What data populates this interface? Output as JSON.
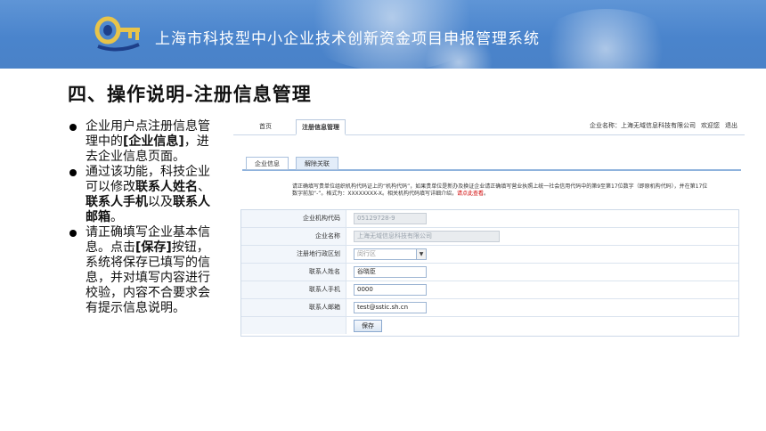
{
  "banner": {
    "title": "上海市科技型中小企业技术创新资金项目申报管理系统",
    "bg_color": "#4a84cc"
  },
  "logo": {
    "icon": "key-logo-icon",
    "color": "#e8c44a"
  },
  "slide": {
    "title": "四、操作说明-注册信息管理"
  },
  "bullets": [
    {
      "parts": [
        {
          "t": "企业用户点注册信息管理中的",
          "b": false
        },
        {
          "t": "[企业信息]",
          "b": true
        },
        {
          "t": "，进去企业信息页面。",
          "b": false
        }
      ]
    },
    {
      "parts": [
        {
          "t": "通过该功能，科技企业可以修改",
          "b": false
        },
        {
          "t": "联系人姓名",
          "b": true
        },
        {
          "t": "、",
          "b": false
        },
        {
          "t": "联系人手机",
          "b": true
        },
        {
          "t": "以及",
          "b": false
        },
        {
          "t": "联系人邮箱",
          "b": true
        },
        {
          "t": "。",
          "b": false
        }
      ]
    },
    {
      "parts": [
        {
          "t": "请正确填写企业基本信息。点击",
          "b": false
        },
        {
          "t": "[保存]",
          "b": true
        },
        {
          "t": "按钮，系统将保存已填写的信息，并对填写内容进行校验，内容不合要求会有提示信息说明。",
          "b": false
        }
      ]
    }
  ],
  "app": {
    "nav": {
      "home": "首页",
      "active_tab": "注册信息管理",
      "company_label": "企业名称：上海无域信息科技有限公司",
      "welcome": "欢迎您",
      "logout": "退出"
    },
    "subtabs": [
      "企业信息",
      "解除关联"
    ],
    "notice_text": "请正确填写贵单位组织机构代码证上的“机构代码”，如果贵单位是新办及换证企业请正确填写营业执照上统一社会信用代码中的第9至第17位数字（即原机构代码），并在第17位数字前加“-”。格式为：XXXXXXXX-X。相关机构代码填写详细介绍，",
    "notice_link": "请点此查看",
    "notice_end": "。",
    "form": {
      "org_code_label": "企业机构代码",
      "org_code_value": "05129728-9",
      "name_label": "企业名称",
      "name_value": "上海无域信息科技有限公司",
      "district_label": "注册地行政区划",
      "district_value": "闵行区",
      "contact_name_label": "联系人姓名",
      "contact_name_value": "谷晓臣",
      "contact_phone_label": "联系人手机",
      "contact_phone_value": "0000",
      "contact_email_label": "联系人邮箱",
      "contact_email_value": "test@sstic.sh.cn",
      "save_label": "保存"
    }
  }
}
